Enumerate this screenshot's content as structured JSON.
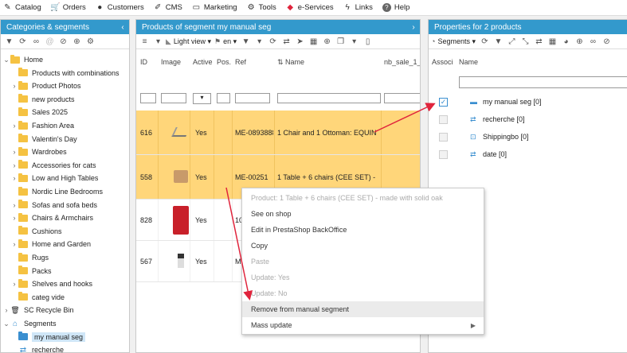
{
  "menu": [
    {
      "label": "Catalog",
      "icon": "pencil-icon"
    },
    {
      "label": "Orders",
      "icon": "cart-icon"
    },
    {
      "label": "Customers",
      "icon": "person-icon"
    },
    {
      "label": "CMS",
      "icon": "edit-icon"
    },
    {
      "label": "Marketing",
      "icon": "megaphone-icon"
    },
    {
      "label": "Tools",
      "icon": "gear-icon"
    },
    {
      "label": "e-Services",
      "icon": "gem-icon"
    },
    {
      "label": "Links",
      "icon": "bolt-icon"
    },
    {
      "label": "Help",
      "icon": "question-icon"
    }
  ],
  "left_panel": {
    "title": "Categories & segments",
    "tree": [
      {
        "label": "Home",
        "arrow": "v",
        "type": "folder",
        "indent": 0
      },
      {
        "label": "Products with combinations",
        "arrow": "",
        "type": "folder",
        "indent": 1
      },
      {
        "label": "Product Photos",
        "arrow": ">",
        "type": "folder",
        "indent": 1
      },
      {
        "label": "new products",
        "arrow": "",
        "type": "folder",
        "indent": 1
      },
      {
        "label": "Sales 2025",
        "arrow": "",
        "type": "folder",
        "indent": 1
      },
      {
        "label": "Fashion Area",
        "arrow": ">",
        "type": "folder",
        "indent": 1
      },
      {
        "label": "Valentin's Day",
        "arrow": "",
        "type": "folder",
        "indent": 1
      },
      {
        "label": "Wardrobes",
        "arrow": ">",
        "type": "folder",
        "indent": 1
      },
      {
        "label": "Accessories for cats",
        "arrow": ">",
        "type": "folder",
        "indent": 1
      },
      {
        "label": "Low and High Tables",
        "arrow": ">",
        "type": "folder",
        "indent": 1
      },
      {
        "label": "Nordic Line Bedrooms",
        "arrow": "",
        "type": "folder",
        "indent": 1
      },
      {
        "label": "Sofas and sofa beds",
        "arrow": ">",
        "type": "folder",
        "indent": 1
      },
      {
        "label": "Chairs & Armchairs",
        "arrow": ">",
        "type": "folder",
        "indent": 1
      },
      {
        "label": "Cushions",
        "arrow": "",
        "type": "folder",
        "indent": 1
      },
      {
        "label": "Home and Garden",
        "arrow": ">",
        "type": "folder",
        "indent": 1
      },
      {
        "label": "Rugs",
        "arrow": "",
        "type": "folder",
        "indent": 1
      },
      {
        "label": "Packs",
        "arrow": "",
        "type": "folder",
        "indent": 1
      },
      {
        "label": "Shelves and hooks",
        "arrow": ">",
        "type": "folder",
        "indent": 1
      },
      {
        "label": "categ vide",
        "arrow": "",
        "type": "folder",
        "indent": 1
      },
      {
        "label": "SC Recycle Bin",
        "arrow": ">",
        "type": "trash",
        "indent": 0
      },
      {
        "label": "Segments",
        "arrow": "v",
        "type": "home",
        "indent": 0
      },
      {
        "label": "my manual seg",
        "arrow": "",
        "type": "blue",
        "indent": 1,
        "selected": true
      },
      {
        "label": "recherche",
        "arrow": "",
        "type": "sync",
        "indent": 1
      }
    ]
  },
  "center_panel": {
    "title": "Products of segment my manual seg",
    "toolbar": {
      "view": "Light view",
      "lang": "en"
    },
    "columns": [
      "ID",
      "Image",
      "Active",
      "Pos.",
      "Ref",
      "Name",
      "nb_sale_1_"
    ],
    "rows": [
      {
        "id": "616",
        "active": "Yes",
        "ref": "ME-0893888",
        "name": "1 Chair and 1 Ottoman: EQUIN",
        "highlight": true,
        "img": "chair"
      },
      {
        "id": "558",
        "active": "Yes",
        "ref": "ME-00251",
        "name": "1 Table + 6 chairs (CEE SET) -",
        "highlight": true,
        "img": "table"
      },
      {
        "id": "828",
        "active": "Yes",
        "ref": "10",
        "name": "",
        "highlight": false,
        "img": "red"
      },
      {
        "id": "567",
        "active": "Yes",
        "ref": "M",
        "name": "",
        "highlight": false,
        "img": "small"
      }
    ]
  },
  "context_menu": [
    {
      "label": "Product: 1 Table + 6 chairs (CEE SET) - made with solid oak",
      "disabled": true
    },
    {
      "label": "See on shop",
      "disabled": false
    },
    {
      "label": "Edit in PrestaShop BackOffice",
      "disabled": false
    },
    {
      "label": "Copy",
      "disabled": false
    },
    {
      "label": "Paste",
      "disabled": true
    },
    {
      "label": "Update: Yes",
      "disabled": true
    },
    {
      "label": "Update: No",
      "disabled": true
    },
    {
      "label": "Remove from manual segment",
      "disabled": false,
      "hover": true
    },
    {
      "label": "Mass update",
      "disabled": false,
      "submenu": true
    }
  ],
  "right_panel": {
    "title": "Properties for 2 products",
    "toolbar_label": "Segments",
    "columns": [
      "Associ",
      "Name"
    ],
    "rows": [
      {
        "label": "my manual seg [0]",
        "checked": true,
        "icon": "folder-icon"
      },
      {
        "label": "recherche [0]",
        "checked": false,
        "icon": "sync-icon"
      },
      {
        "label": "Shippingbo [0]",
        "checked": false,
        "icon": "box-icon"
      },
      {
        "label": "date [0]",
        "checked": false,
        "icon": "sync-icon"
      }
    ]
  },
  "colors": {
    "header": "#3399cc",
    "highlight": "#ffd67a",
    "arrow": "#e0243c"
  }
}
